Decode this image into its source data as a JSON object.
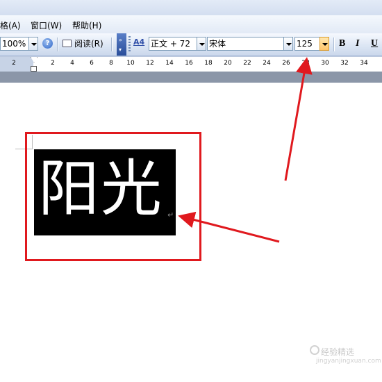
{
  "menu": {
    "items": [
      {
        "label": "格(A)"
      },
      {
        "label": "窗口(W)"
      },
      {
        "label": "帮助(H)"
      }
    ]
  },
  "toolbar": {
    "zoom_value": "100%",
    "read_label": "阅读(R)",
    "style_value": "正文 + 72 ",
    "font_value": "宋体",
    "size_value": "125",
    "bold_label": "B",
    "italic_label": "I",
    "underline_label": "U",
    "help_glyph": "?",
    "style_icon_glyph": "A4"
  },
  "ruler": {
    "labels": [
      "2",
      "2",
      "4",
      "6",
      "8",
      "10",
      "12",
      "14",
      "16",
      "18",
      "20",
      "22",
      "24",
      "26",
      "28",
      "30",
      "32",
      "34"
    ]
  },
  "document": {
    "text": "阳光",
    "paragraph_mark": "↵"
  },
  "watermark": {
    "text": "经验精选",
    "sub": "jingyanjingxuan.com"
  },
  "colors": {
    "annotation_red": "#e0191e",
    "highlight": "#000000",
    "text": "#ffffff"
  }
}
